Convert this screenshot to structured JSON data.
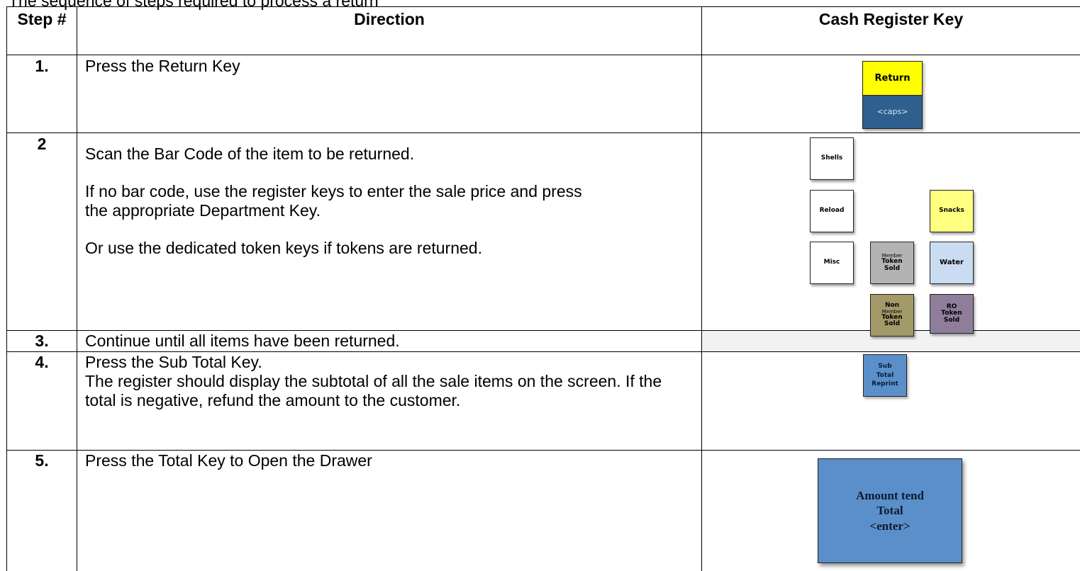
{
  "cut_top_text": "The sequence of steps required to process a return",
  "headers": {
    "step": "Step #",
    "direction": "Direction",
    "key": "Cash Register Key"
  },
  "steps": [
    {
      "num": "1.",
      "direction": [
        "Press the Return Key"
      ]
    },
    {
      "num": "2",
      "direction": [
        "Scan the Bar Code of the item to be returned.",
        "If no bar code, use the register keys to enter the sale price and press the appropriate Department Key.",
        "Or use the dedicated token keys if tokens are returned."
      ]
    },
    {
      "num": "3.",
      "direction": [
        "Continue until all items have been returned."
      ]
    },
    {
      "num": "4.",
      "direction": [
        "Press the Sub Total Key.",
        "The register should display the subtotal of all the sale items on the screen.  If the total is negative, refund the amount to the customer."
      ]
    },
    {
      "num": "5.",
      "direction": [
        "Press the Total Key to Open the Drawer"
      ]
    }
  ],
  "keys": {
    "return_top": "Return",
    "return_bottom": "<caps>",
    "shells": "Shells",
    "reload": "Reload",
    "snacks": "Snacks",
    "misc": "Misc",
    "member_token_small": "Member",
    "member_token_main": "Token\nSold",
    "water": "Water",
    "non_member_top": "Non",
    "non_member_small": "Member",
    "non_member_main": "Token\nSold",
    "ro_token": "RO\nToken\nSold",
    "subtotal": "Sub\nTotal\nReprint",
    "total": "Amount tend\nTotal\n<enter>"
  },
  "colors": {
    "yellow": "#ffff00",
    "dark_blue": "#2e5f8f",
    "light_yellow": "#ffff80",
    "gray": "#b3b3b3",
    "light_blue": "#c9dcf1",
    "khaki": "#a39a6a",
    "purple": "#8e7e9c",
    "mid_blue": "#5b8fca",
    "step3_bg": "#f2f2f2"
  }
}
